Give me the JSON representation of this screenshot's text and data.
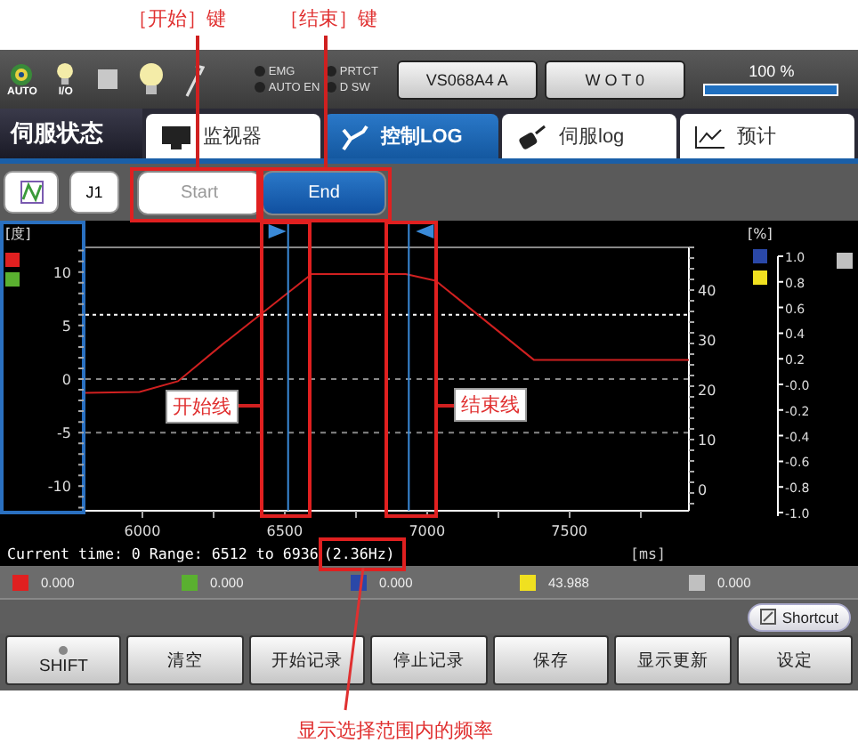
{
  "callouts": {
    "start_key": "［开始］键",
    "end_key": "［结束］键",
    "start_line": "开始线",
    "end_line": "结束线",
    "frequency_note": "显示选择范围内的频率"
  },
  "status_bar": {
    "icons": [
      {
        "kind": "swirl",
        "label": "AUTO"
      },
      {
        "kind": "bulb",
        "label": "I/O"
      },
      {
        "kind": "square"
      },
      {
        "kind": "bulb"
      },
      {
        "kind": "wrench"
      }
    ],
    "indicators": [
      {
        "label": "EMG",
        "on": false
      },
      {
        "label": "PRTCT",
        "on": false
      },
      {
        "label": "AUTO EN",
        "on": false
      },
      {
        "label": "D SW",
        "on": false
      }
    ],
    "buttons": [
      "VS068A4 A",
      "W O T 0"
    ],
    "speed": {
      "reading": "100 %",
      "level": 1.0
    }
  },
  "section_title": "伺服状态",
  "tabs": [
    {
      "label": "监视器",
      "kind": "monitor",
      "selected": false
    },
    {
      "label": "控制LOG",
      "kind": "arm",
      "selected": true
    },
    {
      "label": "伺服log",
      "kind": "servo",
      "selected": false
    },
    {
      "label": "预计",
      "kind": "graph",
      "selected": false
    }
  ],
  "toolbar": {
    "axis_button": "J1",
    "range_buttons": [
      {
        "label": "Start",
        "selected": false
      },
      {
        "label": "End",
        "selected": true
      }
    ]
  },
  "chart": {
    "left_unit": "[度]",
    "mid_ticks": [
      "40",
      "30",
      "20",
      "10",
      "0"
    ],
    "right_unit": "[%]",
    "right_ticks": [
      "1.0",
      "0.8",
      "0.6",
      "0.4",
      "0.2",
      "-0.0",
      "-0.2",
      "-0.4",
      "-0.6",
      "-0.8",
      "-1.0"
    ],
    "x_unit": "[ms]",
    "chart_data": {
      "type": "line",
      "x": [
        5800,
        5990,
        6125,
        6280,
        6595,
        6925,
        7030,
        7375,
        7920
      ],
      "series": [
        {
          "color": "#d02020",
          "values": [
            -1.3,
            -1.2,
            -0.2,
            3.2,
            9.8,
            9.8,
            9.2,
            1.8,
            1.8
          ]
        }
      ],
      "xlim": [
        5800,
        7920
      ],
      "ylim": [
        -12.3,
        12.3
      ],
      "xticks": [
        6000,
        6500,
        7000,
        7500
      ],
      "ref_lines": [
        {
          "axis": "x",
          "value": 6512
        },
        {
          "axis": "x",
          "value": 6936
        },
        {
          "axis": "y",
          "value": 6
        }
      ],
      "yticks": [
        {
          "value": 10,
          "label": "10"
        },
        {
          "value": 5,
          "label": "5"
        },
        {
          "value": 0,
          "label": "0"
        },
        {
          "value": -5,
          "label": "-5"
        },
        {
          "value": -10,
          "label": "-10"
        }
      ]
    }
  },
  "info": {
    "text": "Current time: 0 Range: 6512 to 6936",
    "frequency": "(2.36Hz)"
  },
  "channels": [
    {
      "color": "#e02020",
      "value": "0.000"
    },
    {
      "color": "#5ab030",
      "value": "0.000"
    },
    {
      "color": "#2a48a8",
      "value": "0.000"
    },
    {
      "color": "#f0e020",
      "value": "43.988"
    },
    {
      "color": "#c0c0c0",
      "value": "0.000"
    }
  ],
  "shortcut": "Shortcut",
  "buttons": [
    {
      "label": "SHIFT",
      "kind": "shift"
    },
    {
      "label": "清空",
      "kind": "plain"
    },
    {
      "label": "开始记录",
      "kind": "plain"
    },
    {
      "label": "停止记录",
      "kind": "plain"
    },
    {
      "label": "保存",
      "kind": "plain"
    },
    {
      "label": "显示更新",
      "kind": "plain"
    },
    {
      "label": "设定",
      "kind": "plain"
    }
  ]
}
